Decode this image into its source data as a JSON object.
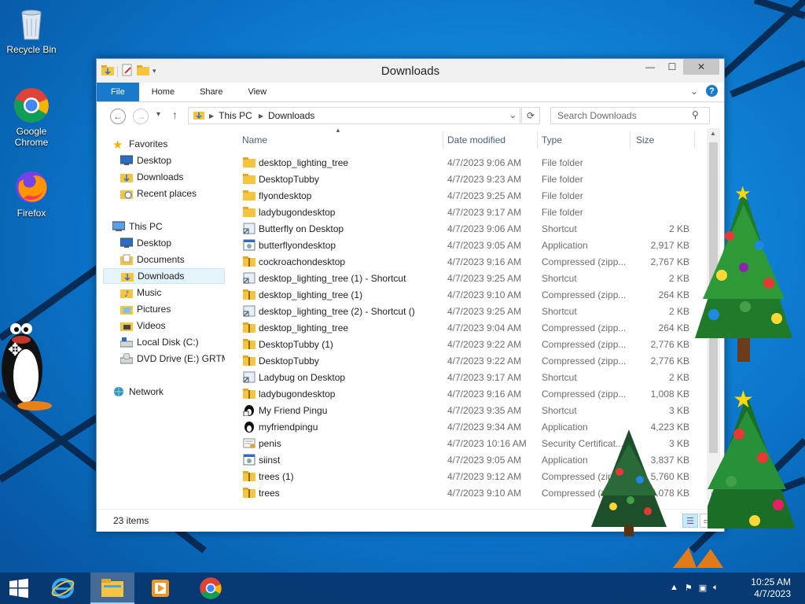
{
  "desktop": {
    "icons": [
      {
        "label": "Recycle Bin",
        "icon": "recycle-bin-icon"
      },
      {
        "label": "Google\nChrome",
        "icon": "chrome-icon"
      },
      {
        "label": "Firefox",
        "icon": "firefox-icon"
      }
    ]
  },
  "window": {
    "title": "Downloads",
    "controls": {
      "minimize": "—",
      "maximize": "☐",
      "close": "✕"
    }
  },
  "ribbon": {
    "tabs": [
      "File",
      "Home",
      "Share",
      "View"
    ],
    "help": "?",
    "expand": "⌄"
  },
  "navbar": {
    "back": "←",
    "forward": "→",
    "recent": "▾",
    "up": "↑",
    "breadcrumb": [
      "This PC",
      "Downloads"
    ],
    "search_placeholder": "Search Downloads"
  },
  "navpane": {
    "items": [
      {
        "label": "Favorites",
        "icon": "star-icon",
        "level": 0
      },
      {
        "label": "Desktop",
        "icon": "desktop-icon",
        "level": 1
      },
      {
        "label": "Downloads",
        "icon": "downloads-icon",
        "level": 1
      },
      {
        "label": "Recent places",
        "icon": "recent-places-icon",
        "level": 1
      },
      {
        "label": "This PC",
        "icon": "computer-icon",
        "level": 0
      },
      {
        "label": "Desktop",
        "icon": "desktop-icon",
        "level": 1
      },
      {
        "label": "Documents",
        "icon": "documents-icon",
        "level": 1
      },
      {
        "label": "Downloads",
        "icon": "downloads-icon",
        "level": 1,
        "selected": true
      },
      {
        "label": "Music",
        "icon": "music-icon",
        "level": 1
      },
      {
        "label": "Pictures",
        "icon": "pictures-icon",
        "level": 1
      },
      {
        "label": "Videos",
        "icon": "videos-icon",
        "level": 1
      },
      {
        "label": "Local Disk (C:)",
        "icon": "local-disk-icon",
        "level": 1
      },
      {
        "label": "DVD Drive (E:) GRTM",
        "icon": "dvd-drive-icon",
        "level": 1
      },
      {
        "label": "Network",
        "icon": "network-icon",
        "level": 0
      }
    ]
  },
  "filelist": {
    "columns": [
      "Name",
      "Date modified",
      "Type",
      "Size"
    ],
    "rows": [
      {
        "name": "desktop_lighting_tree",
        "date": "4/7/2023 9:06 AM",
        "type": "File folder",
        "size": "",
        "icon": "folder-icon"
      },
      {
        "name": "DesktopTubby",
        "date": "4/7/2023 9:23 AM",
        "type": "File folder",
        "size": "",
        "icon": "folder-icon"
      },
      {
        "name": "flyondesktop",
        "date": "4/7/2023 9:25 AM",
        "type": "File folder",
        "size": "",
        "icon": "folder-icon"
      },
      {
        "name": "ladybugondesktop",
        "date": "4/7/2023 9:17 AM",
        "type": "File folder",
        "size": "",
        "icon": "folder-icon"
      },
      {
        "name": "Butterfly on Desktop",
        "date": "4/7/2023 9:06 AM",
        "type": "Shortcut",
        "size": "2 KB",
        "icon": "shortcut-icon"
      },
      {
        "name": "butterflyondesktop",
        "date": "4/7/2023 9:05 AM",
        "type": "Application",
        "size": "2,917 KB",
        "icon": "application-icon"
      },
      {
        "name": "cockroachondesktop",
        "date": "4/7/2023 9:16 AM",
        "type": "Compressed (zipp...",
        "size": "2,767 KB",
        "icon": "zip-folder-icon"
      },
      {
        "name": "desktop_lighting_tree (1) - Shortcut",
        "date": "4/7/2023 9:25 AM",
        "type": "Shortcut",
        "size": "2 KB",
        "icon": "shortcut-icon"
      },
      {
        "name": "desktop_lighting_tree (1)",
        "date": "4/7/2023 9:10 AM",
        "type": "Compressed (zipp...",
        "size": "264 KB",
        "icon": "zip-folder-icon"
      },
      {
        "name": "desktop_lighting_tree (2) - Shortcut ()",
        "date": "4/7/2023 9:25 AM",
        "type": "Shortcut",
        "size": "2 KB",
        "icon": "shortcut-icon"
      },
      {
        "name": "desktop_lighting_tree",
        "date": "4/7/2023 9:04 AM",
        "type": "Compressed (zipp...",
        "size": "264 KB",
        "icon": "zip-folder-icon"
      },
      {
        "name": "DesktopTubby (1)",
        "date": "4/7/2023 9:22 AM",
        "type": "Compressed (zipp...",
        "size": "2,776 KB",
        "icon": "zip-folder-icon"
      },
      {
        "name": "DesktopTubby",
        "date": "4/7/2023 9:22 AM",
        "type": "Compressed (zipp...",
        "size": "2,776 KB",
        "icon": "zip-folder-icon"
      },
      {
        "name": "Ladybug on Desktop",
        "date": "4/7/2023 9:17 AM",
        "type": "Shortcut",
        "size": "2 KB",
        "icon": "shortcut-icon"
      },
      {
        "name": "ladybugondesktop",
        "date": "4/7/2023 9:16 AM",
        "type": "Compressed (zipp...",
        "size": "1,008 KB",
        "icon": "zip-folder-icon"
      },
      {
        "name": "My Friend Pingu",
        "date": "4/7/2023 9:35 AM",
        "type": "Shortcut",
        "size": "3 KB",
        "icon": "pingu-shortcut-icon"
      },
      {
        "name": "myfriendpingu",
        "date": "4/7/2023 9:34 AM",
        "type": "Application",
        "size": "4,223 KB",
        "icon": "pingu-app-icon"
      },
      {
        "name": "penis",
        "date": "4/7/2023 10:16 AM",
        "type": "Security Certificat...",
        "size": "3 KB",
        "icon": "certificate-icon"
      },
      {
        "name": "siinst",
        "date": "4/7/2023 9:05 AM",
        "type": "Application",
        "size": "3,837 KB",
        "icon": "application-icon"
      },
      {
        "name": "trees (1)",
        "date": "4/7/2023 9:12 AM",
        "type": "Compressed (zipp...",
        "size": "5,760 KB",
        "icon": "zip-folder-icon"
      },
      {
        "name": "trees",
        "date": "4/7/2023 9:10 AM",
        "type": "Compressed (zipp...",
        "size": "4,078 KB",
        "icon": "zip-folder-icon"
      }
    ]
  },
  "status": {
    "item_count": "23 items"
  },
  "taskbar": {
    "apps": [
      "start-icon",
      "internet-explorer-icon",
      "file-explorer-icon",
      "media-player-icon",
      "chrome-icon"
    ],
    "time": "10:25 AM",
    "date": "4/7/2023"
  }
}
